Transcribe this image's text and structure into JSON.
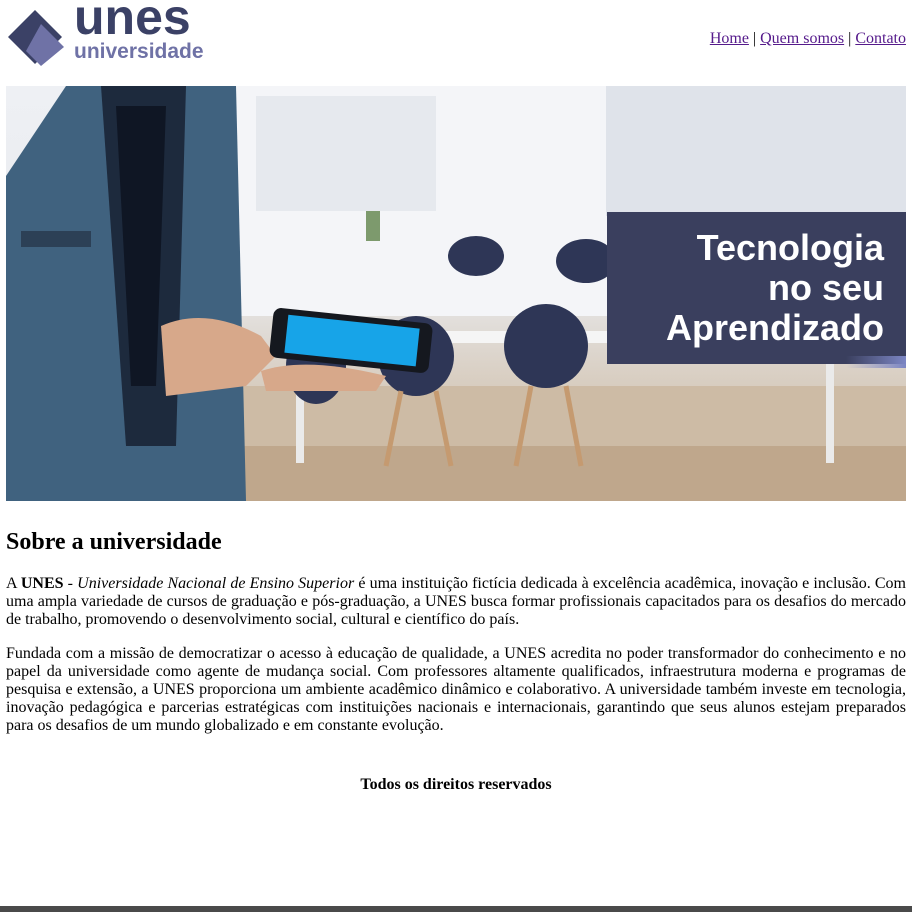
{
  "header": {
    "logo": {
      "main_text": "unes",
      "sub_text": "universidade",
      "icon": "diamond-logo-icon",
      "colors": {
        "primary": "#3b4166",
        "secondary": "#6f72a6"
      }
    },
    "nav": {
      "items": [
        {
          "label": "Home"
        },
        {
          "label": "Quem somos"
        },
        {
          "label": "Contato"
        }
      ],
      "separator": "|"
    }
  },
  "hero": {
    "banner_text": "Tecnologia\nno seu\nAprendizado",
    "banner_color": "#3a3f5e"
  },
  "about": {
    "title": "Sobre a universidade",
    "p1": {
      "prefix": "A ",
      "brand": "UNES",
      "dash": " - ",
      "full_name": "Universidade Nacional de Ensino Superior",
      "rest": " é uma instituição fictícia dedicada à excelência acadêmica, inovação e inclusão. Com uma ampla variedade de cursos de graduação e pós-graduação, a UNES busca formar profissionais capacitados para os desafios do mercado de trabalho, promovendo o desenvolvimento social, cultural e científico do país."
    },
    "p2": "Fundada com a missão de democratizar o acesso à educação de qualidade, a UNES acredita no poder transformador do conhecimento e no papel da universidade como agente de mudança social. Com professores altamente qualificados, infraestrutura moderna e programas de pesquisa e extensão, a UNES proporciona um ambiente acadêmico dinâmico e colaborativo. A universidade também investe em tecnologia, inovação pedagógica e parcerias estratégicas com instituições nacionais e internacionais, garantindo que seus alunos estejam preparados para os desafios de um mundo globalizado e em constante evolução."
  },
  "footer": {
    "text": "Todos os direitos reservados"
  }
}
